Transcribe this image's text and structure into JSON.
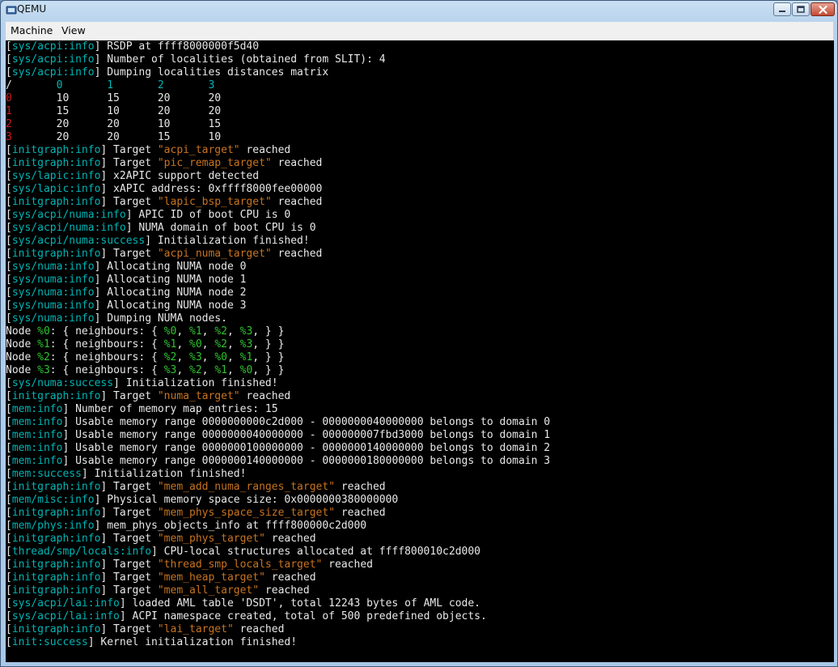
{
  "window": {
    "title": "QEMU",
    "menu": [
      "Machine",
      "View"
    ]
  },
  "colors": {
    "tag": "#00b5b5",
    "target": "#c8731f",
    "row_index": "#d01a1a",
    "node_ref": "#2fc22f",
    "text": "#e8e8e8",
    "background": "#000000"
  },
  "console_lines": [
    [
      {
        "t": "[",
        "c": "white"
      },
      {
        "t": "sys/acpi:info",
        "c": "cyan"
      },
      {
        "t": "] RSDP at ffff8000000f5d40",
        "c": "white"
      }
    ],
    [
      {
        "t": "[",
        "c": "white"
      },
      {
        "t": "sys/acpi:info",
        "c": "cyan"
      },
      {
        "t": "] Number of localities (obtained from SLIT): 4",
        "c": "white"
      }
    ],
    [
      {
        "t": "[",
        "c": "white"
      },
      {
        "t": "sys/acpi:info",
        "c": "cyan"
      },
      {
        "t": "] Dumping localities distances matrix",
        "c": "white"
      }
    ],
    [
      {
        "t": "/       ",
        "c": "white"
      },
      {
        "t": "0",
        "c": "cyan"
      },
      {
        "t": "       ",
        "c": "white"
      },
      {
        "t": "1",
        "c": "cyan"
      },
      {
        "t": "       ",
        "c": "white"
      },
      {
        "t": "2",
        "c": "cyan"
      },
      {
        "t": "       ",
        "c": "white"
      },
      {
        "t": "3",
        "c": "cyan"
      }
    ],
    [
      {
        "t": "0",
        "c": "red"
      },
      {
        "t": "       10      15      20      20",
        "c": "white"
      }
    ],
    [
      {
        "t": "1",
        "c": "red"
      },
      {
        "t": "       15      10      20      20",
        "c": "white"
      }
    ],
    [
      {
        "t": "2",
        "c": "red"
      },
      {
        "t": "       20      20      10      15",
        "c": "white"
      }
    ],
    [
      {
        "t": "3",
        "c": "red"
      },
      {
        "t": "       20      20      15      10",
        "c": "white"
      }
    ],
    [
      {
        "t": "[",
        "c": "white"
      },
      {
        "t": "initgraph:info",
        "c": "cyan"
      },
      {
        "t": "] Target ",
        "c": "white"
      },
      {
        "t": "\"acpi_target\"",
        "c": "orange"
      },
      {
        "t": " reached",
        "c": "white"
      }
    ],
    [
      {
        "t": "[",
        "c": "white"
      },
      {
        "t": "initgraph:info",
        "c": "cyan"
      },
      {
        "t": "] Target ",
        "c": "white"
      },
      {
        "t": "\"pic_remap_target\"",
        "c": "orange"
      },
      {
        "t": " reached",
        "c": "white"
      }
    ],
    [
      {
        "t": "[",
        "c": "white"
      },
      {
        "t": "sys/lapic:info",
        "c": "cyan"
      },
      {
        "t": "] x2APIC support detected",
        "c": "white"
      }
    ],
    [
      {
        "t": "[",
        "c": "white"
      },
      {
        "t": "sys/lapic:info",
        "c": "cyan"
      },
      {
        "t": "] xAPIC address: 0xffff8000fee00000",
        "c": "white"
      }
    ],
    [
      {
        "t": "[",
        "c": "white"
      },
      {
        "t": "initgraph:info",
        "c": "cyan"
      },
      {
        "t": "] Target ",
        "c": "white"
      },
      {
        "t": "\"lapic_bsp_target\"",
        "c": "orange"
      },
      {
        "t": " reached",
        "c": "white"
      }
    ],
    [
      {
        "t": "[",
        "c": "white"
      },
      {
        "t": "sys/acpi/numa:info",
        "c": "cyan"
      },
      {
        "t": "] APIC ID of boot CPU is 0",
        "c": "white"
      }
    ],
    [
      {
        "t": "[",
        "c": "white"
      },
      {
        "t": "sys/acpi/numa:info",
        "c": "cyan"
      },
      {
        "t": "] NUMA domain of boot CPU is 0",
        "c": "white"
      }
    ],
    [
      {
        "t": "[",
        "c": "white"
      },
      {
        "t": "sys/acpi/numa:success",
        "c": "cyan"
      },
      {
        "t": "] Initialization finished!",
        "c": "white"
      }
    ],
    [
      {
        "t": "[",
        "c": "white"
      },
      {
        "t": "initgraph:info",
        "c": "cyan"
      },
      {
        "t": "] Target ",
        "c": "white"
      },
      {
        "t": "\"acpi_numa_target\"",
        "c": "orange"
      },
      {
        "t": " reached",
        "c": "white"
      }
    ],
    [
      {
        "t": "[",
        "c": "white"
      },
      {
        "t": "sys/numa:info",
        "c": "cyan"
      },
      {
        "t": "] Allocating NUMA node 0",
        "c": "white"
      }
    ],
    [
      {
        "t": "[",
        "c": "white"
      },
      {
        "t": "sys/numa:info",
        "c": "cyan"
      },
      {
        "t": "] Allocating NUMA node 1",
        "c": "white"
      }
    ],
    [
      {
        "t": "[",
        "c": "white"
      },
      {
        "t": "sys/numa:info",
        "c": "cyan"
      },
      {
        "t": "] Allocating NUMA node 2",
        "c": "white"
      }
    ],
    [
      {
        "t": "[",
        "c": "white"
      },
      {
        "t": "sys/numa:info",
        "c": "cyan"
      },
      {
        "t": "] Allocating NUMA node 3",
        "c": "white"
      }
    ],
    [
      {
        "t": "[",
        "c": "white"
      },
      {
        "t": "sys/numa:info",
        "c": "cyan"
      },
      {
        "t": "] Dumping NUMA nodes.",
        "c": "white"
      }
    ],
    [
      {
        "t": "Node ",
        "c": "white"
      },
      {
        "t": "%0",
        "c": "green"
      },
      {
        "t": ": { neighbours: { ",
        "c": "white"
      },
      {
        "t": "%0",
        "c": "green"
      },
      {
        "t": ", ",
        "c": "white"
      },
      {
        "t": "%1",
        "c": "green"
      },
      {
        "t": ", ",
        "c": "white"
      },
      {
        "t": "%2",
        "c": "green"
      },
      {
        "t": ", ",
        "c": "white"
      },
      {
        "t": "%3",
        "c": "green"
      },
      {
        "t": ", } }",
        "c": "white"
      }
    ],
    [
      {
        "t": "Node ",
        "c": "white"
      },
      {
        "t": "%1",
        "c": "green"
      },
      {
        "t": ": { neighbours: { ",
        "c": "white"
      },
      {
        "t": "%1",
        "c": "green"
      },
      {
        "t": ", ",
        "c": "white"
      },
      {
        "t": "%0",
        "c": "green"
      },
      {
        "t": ", ",
        "c": "white"
      },
      {
        "t": "%2",
        "c": "green"
      },
      {
        "t": ", ",
        "c": "white"
      },
      {
        "t": "%3",
        "c": "green"
      },
      {
        "t": ", } }",
        "c": "white"
      }
    ],
    [
      {
        "t": "Node ",
        "c": "white"
      },
      {
        "t": "%2",
        "c": "green"
      },
      {
        "t": ": { neighbours: { ",
        "c": "white"
      },
      {
        "t": "%2",
        "c": "green"
      },
      {
        "t": ", ",
        "c": "white"
      },
      {
        "t": "%3",
        "c": "green"
      },
      {
        "t": ", ",
        "c": "white"
      },
      {
        "t": "%0",
        "c": "green"
      },
      {
        "t": ", ",
        "c": "white"
      },
      {
        "t": "%1",
        "c": "green"
      },
      {
        "t": ", } }",
        "c": "white"
      }
    ],
    [
      {
        "t": "Node ",
        "c": "white"
      },
      {
        "t": "%3",
        "c": "green"
      },
      {
        "t": ": { neighbours: { ",
        "c": "white"
      },
      {
        "t": "%3",
        "c": "green"
      },
      {
        "t": ", ",
        "c": "white"
      },
      {
        "t": "%2",
        "c": "green"
      },
      {
        "t": ", ",
        "c": "white"
      },
      {
        "t": "%1",
        "c": "green"
      },
      {
        "t": ", ",
        "c": "white"
      },
      {
        "t": "%0",
        "c": "green"
      },
      {
        "t": ", } }",
        "c": "white"
      }
    ],
    [
      {
        "t": "[",
        "c": "white"
      },
      {
        "t": "sys/numa:success",
        "c": "cyan"
      },
      {
        "t": "] Initialization finished!",
        "c": "white"
      }
    ],
    [
      {
        "t": "[",
        "c": "white"
      },
      {
        "t": "initgraph:info",
        "c": "cyan"
      },
      {
        "t": "] Target ",
        "c": "white"
      },
      {
        "t": "\"numa_target\"",
        "c": "orange"
      },
      {
        "t": " reached",
        "c": "white"
      }
    ],
    [
      {
        "t": "[",
        "c": "white"
      },
      {
        "t": "mem:info",
        "c": "cyan"
      },
      {
        "t": "] Number of memory map entries: 15",
        "c": "white"
      }
    ],
    [
      {
        "t": "[",
        "c": "white"
      },
      {
        "t": "mem:info",
        "c": "cyan"
      },
      {
        "t": "] Usable memory range 0000000000c2d000 - 0000000040000000 belongs to domain 0",
        "c": "white"
      }
    ],
    [
      {
        "t": "[",
        "c": "white"
      },
      {
        "t": "mem:info",
        "c": "cyan"
      },
      {
        "t": "] Usable memory range 0000000040000000 - 000000007fbd3000 belongs to domain 1",
        "c": "white"
      }
    ],
    [
      {
        "t": "[",
        "c": "white"
      },
      {
        "t": "mem:info",
        "c": "cyan"
      },
      {
        "t": "] Usable memory range 0000000100000000 - 0000000140000000 belongs to domain 2",
        "c": "white"
      }
    ],
    [
      {
        "t": "[",
        "c": "white"
      },
      {
        "t": "mem:info",
        "c": "cyan"
      },
      {
        "t": "] Usable memory range 0000000140000000 - 0000000180000000 belongs to domain 3",
        "c": "white"
      }
    ],
    [
      {
        "t": "[",
        "c": "white"
      },
      {
        "t": "mem:success",
        "c": "cyan"
      },
      {
        "t": "] Initialization finished!",
        "c": "white"
      }
    ],
    [
      {
        "t": "[",
        "c": "white"
      },
      {
        "t": "initgraph:info",
        "c": "cyan"
      },
      {
        "t": "] Target ",
        "c": "white"
      },
      {
        "t": "\"mem_add_numa_ranges_target\"",
        "c": "orange"
      },
      {
        "t": " reached",
        "c": "white"
      }
    ],
    [
      {
        "t": "[",
        "c": "white"
      },
      {
        "t": "mem/misc:info",
        "c": "cyan"
      },
      {
        "t": "] Physical memory space size: 0x0000000380000000",
        "c": "white"
      }
    ],
    [
      {
        "t": "[",
        "c": "white"
      },
      {
        "t": "initgraph:info",
        "c": "cyan"
      },
      {
        "t": "] Target ",
        "c": "white"
      },
      {
        "t": "\"mem_phys_space_size_target\"",
        "c": "orange"
      },
      {
        "t": " reached",
        "c": "white"
      }
    ],
    [
      {
        "t": "[",
        "c": "white"
      },
      {
        "t": "mem/phys:info",
        "c": "cyan"
      },
      {
        "t": "] mem_phys_objects_info at ffff800000c2d000",
        "c": "white"
      }
    ],
    [
      {
        "t": "[",
        "c": "white"
      },
      {
        "t": "initgraph:info",
        "c": "cyan"
      },
      {
        "t": "] Target ",
        "c": "white"
      },
      {
        "t": "\"mem_phys_target\"",
        "c": "orange"
      },
      {
        "t": " reached",
        "c": "white"
      }
    ],
    [
      {
        "t": "[",
        "c": "white"
      },
      {
        "t": "thread/smp/locals:info",
        "c": "cyan"
      },
      {
        "t": "] CPU-local structures allocated at ffff800010c2d000",
        "c": "white"
      }
    ],
    [
      {
        "t": "[",
        "c": "white"
      },
      {
        "t": "initgraph:info",
        "c": "cyan"
      },
      {
        "t": "] Target ",
        "c": "white"
      },
      {
        "t": "\"thread_smp_locals_target\"",
        "c": "orange"
      },
      {
        "t": " reached",
        "c": "white"
      }
    ],
    [
      {
        "t": "[",
        "c": "white"
      },
      {
        "t": "initgraph:info",
        "c": "cyan"
      },
      {
        "t": "] Target ",
        "c": "white"
      },
      {
        "t": "\"mem_heap_target\"",
        "c": "orange"
      },
      {
        "t": " reached",
        "c": "white"
      }
    ],
    [
      {
        "t": "[",
        "c": "white"
      },
      {
        "t": "initgraph:info",
        "c": "cyan"
      },
      {
        "t": "] Target ",
        "c": "white"
      },
      {
        "t": "\"mem_all_target\"",
        "c": "orange"
      },
      {
        "t": " reached",
        "c": "white"
      }
    ],
    [
      {
        "t": "[",
        "c": "white"
      },
      {
        "t": "sys/acpi/lai:info",
        "c": "cyan"
      },
      {
        "t": "] loaded AML table 'DSDT', total 12243 bytes of AML code.",
        "c": "white"
      }
    ],
    [
      {
        "t": "[",
        "c": "white"
      },
      {
        "t": "sys/acpi/lai:info",
        "c": "cyan"
      },
      {
        "t": "] ACPI namespace created, total of 500 predefined objects.",
        "c": "white"
      }
    ],
    [
      {
        "t": "[",
        "c": "white"
      },
      {
        "t": "initgraph:info",
        "c": "cyan"
      },
      {
        "t": "] Target ",
        "c": "white"
      },
      {
        "t": "\"lai_target\"",
        "c": "orange"
      },
      {
        "t": " reached",
        "c": "white"
      }
    ],
    [
      {
        "t": "[",
        "c": "white"
      },
      {
        "t": "init:success",
        "c": "cyan"
      },
      {
        "t": "] Kernel initialization finished!",
        "c": "white"
      }
    ]
  ]
}
